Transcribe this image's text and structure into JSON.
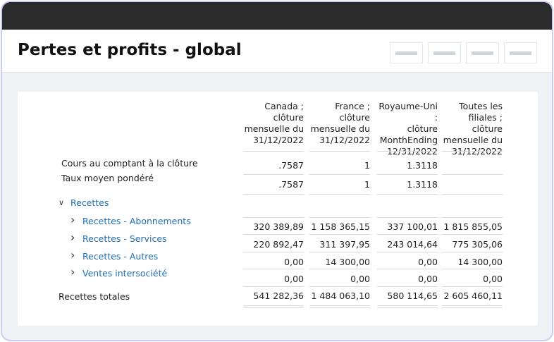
{
  "title": "Pertes et profits - global",
  "columns": [
    "Canada ; clôture mensuelle du 31/12/2022",
    "France ; clôture mensuelle du 31/12/2022",
    "Royaume-Uni : clôture MonthEnding 12/31/2022",
    "Toutes les filiales ; clôture mensuelle du 31/12/2022"
  ],
  "columns_lines": [
    [
      "Canada ;",
      "clôture",
      "mensuelle du",
      "31/12/2022"
    ],
    [
      "France ;",
      "clôture",
      "mensuelle du",
      "31/12/2022"
    ],
    [
      "Royaume-Uni :",
      "clôture",
      "MonthEnding",
      "12/31/2022"
    ],
    [
      "Toutes les",
      "filiales ; clôture",
      "mensuelle du",
      "31/12/2022"
    ]
  ],
  "rows": [
    {
      "label": "Cours au comptant à la clôture",
      "values": [
        ".7587",
        "1",
        "1.3118",
        ""
      ]
    },
    {
      "label": "Taux moyen pondéré",
      "values": [
        ".7587",
        "1",
        "1.3118",
        ""
      ]
    },
    {
      "label": "Recettes",
      "values": [
        "",
        "",
        "",
        ""
      ]
    },
    {
      "label": "Recettes - Abonnements",
      "values": [
        "320 389,89",
        "1 158 365,15",
        "337 100,01",
        "1 815 855,05"
      ]
    },
    {
      "label": "Recettes - Services",
      "values": [
        "220 892,47",
        "311 397,95",
        "243 014,64",
        "775 305,06"
      ]
    },
    {
      "label": "Recettes - Autres",
      "values": [
        "0,00",
        "14 300,00",
        "0,00",
        "14 300,00"
      ]
    },
    {
      "label": "Ventes intersociété",
      "values": [
        "0,00",
        "0,00",
        "0,00",
        "0,00"
      ]
    },
    {
      "label": "Recettes totales",
      "values": [
        "541 282,36",
        "1 484 063,10",
        "580 114,65",
        "2 605 460,11"
      ]
    }
  ]
}
